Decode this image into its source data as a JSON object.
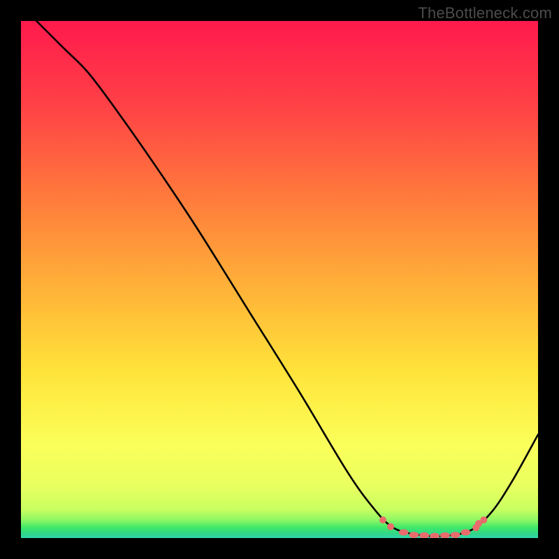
{
  "watermark": "TheBottleneck.com",
  "chart_data": {
    "type": "line",
    "title": "",
    "xlabel": "",
    "ylabel": "",
    "xlim": [
      0,
      100
    ],
    "ylim": [
      0,
      100
    ],
    "background_gradient": {
      "top": "#ff1a4d",
      "mid_upper": "#ff8a3a",
      "mid": "#ffe43a",
      "mid_lower": "#fbff5a",
      "green_band": "#3fe86a",
      "cyan_edge": "#2fd6af"
    },
    "series": [
      {
        "name": "curve",
        "color": "#000000",
        "width": 2.5,
        "points": [
          {
            "x": 3,
            "y": 100
          },
          {
            "x": 8,
            "y": 95
          },
          {
            "x": 13,
            "y": 90
          },
          {
            "x": 19,
            "y": 82
          },
          {
            "x": 26,
            "y": 72
          },
          {
            "x": 34,
            "y": 60
          },
          {
            "x": 44,
            "y": 44
          },
          {
            "x": 54,
            "y": 28
          },
          {
            "x": 63,
            "y": 13
          },
          {
            "x": 68,
            "y": 6
          },
          {
            "x": 72,
            "y": 2
          },
          {
            "x": 77,
            "y": 0.6
          },
          {
            "x": 82,
            "y": 0.4
          },
          {
            "x": 87,
            "y": 1.5
          },
          {
            "x": 91,
            "y": 5
          },
          {
            "x": 95,
            "y": 11
          },
          {
            "x": 100,
            "y": 20
          }
        ]
      }
    ],
    "sweet_spot_markers": {
      "color": "#e86c6c",
      "points": [
        {
          "x": 70,
          "y": 3.5
        },
        {
          "x": 71.5,
          "y": 2.2
        },
        {
          "x": 74,
          "y": 1.1
        },
        {
          "x": 76,
          "y": 0.6
        },
        {
          "x": 78,
          "y": 0.5
        },
        {
          "x": 80,
          "y": 0.4
        },
        {
          "x": 82,
          "y": 0.5
        },
        {
          "x": 84,
          "y": 0.6
        },
        {
          "x": 86,
          "y": 1.1
        },
        {
          "x": 88,
          "y": 2.0
        },
        {
          "x": 88.5,
          "y": 2.8
        },
        {
          "x": 89.5,
          "y": 3.5
        }
      ]
    }
  }
}
